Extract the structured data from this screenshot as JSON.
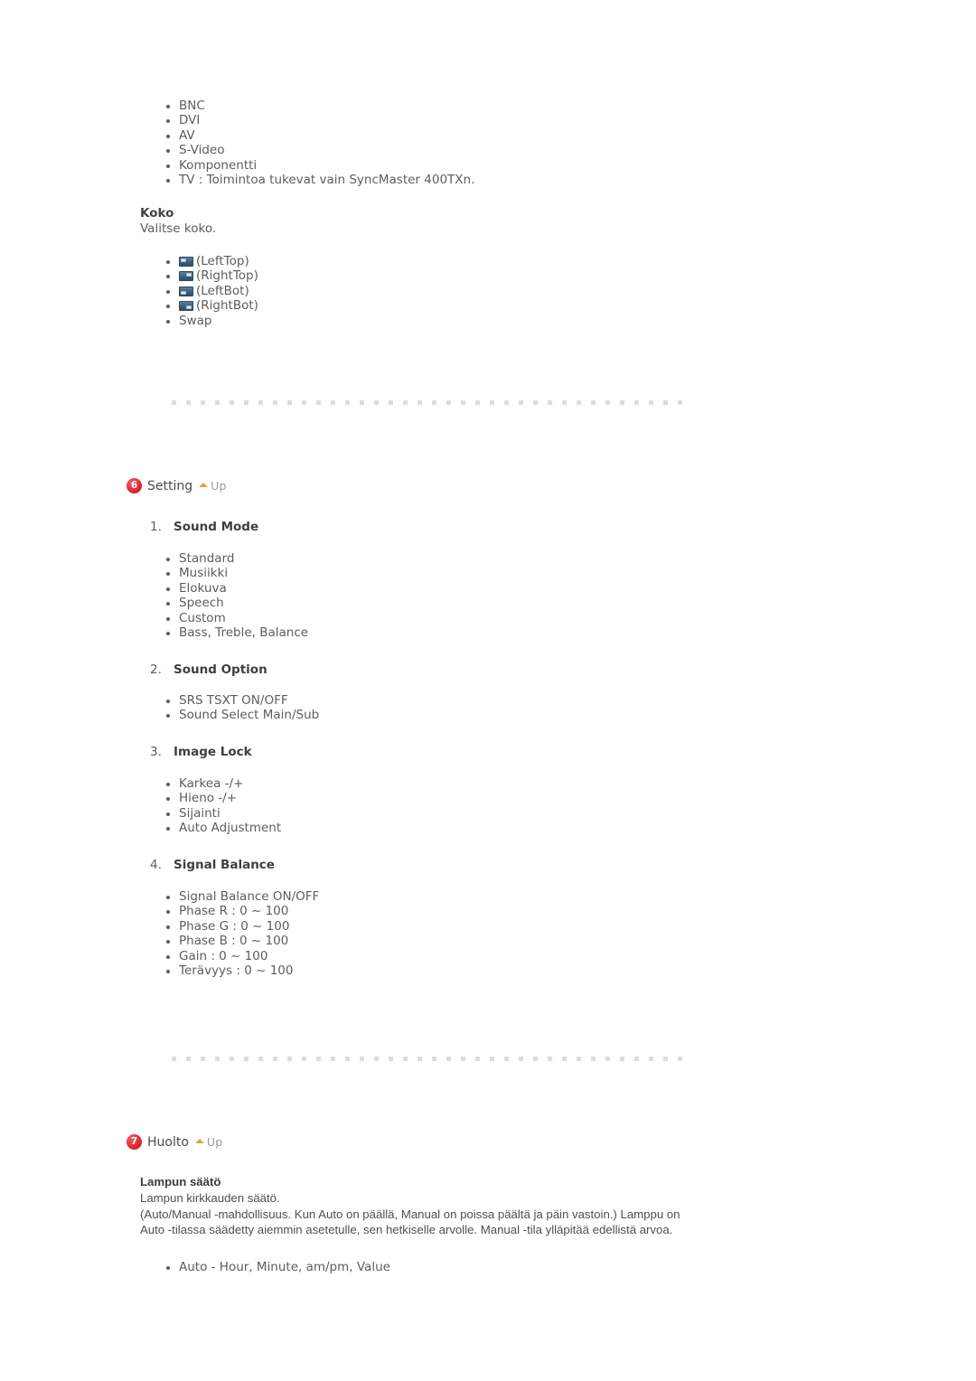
{
  "document": {
    "language": "fi",
    "background_color": "#ffffff",
    "text_color": "#5d5d5d",
    "heading_color": "#3f3f3f",
    "badge_color": "#e12a33",
    "up_arrow_color": "#e8a33d",
    "divider_color": "#dcdcdc",
    "pip_icon_color": "#3f6482"
  },
  "source_list": {
    "items": [
      "BNC",
      "DVI",
      "AV",
      "S-Video",
      "Komponentti",
      "TV : Toimintoa tukevat vain SyncMaster 400TXn."
    ]
  },
  "koko": {
    "title": "Koko",
    "description": "Valitse koko.",
    "items": [
      {
        "icon": "pip-position-lefttop-icon",
        "label": "(LeftTop)"
      },
      {
        "icon": "pip-position-righttop-icon",
        "label": "(RightTop)"
      },
      {
        "icon": "pip-position-leftbot-icon",
        "label": "(LeftBot)"
      },
      {
        "icon": "pip-position-rightbot-icon",
        "label": "(RightBot)"
      },
      {
        "icon": "",
        "label": "Swap"
      }
    ]
  },
  "setting_section": {
    "badge": "6",
    "title": "Setting",
    "up_label": "Up",
    "items": [
      {
        "number": "1.",
        "title": "Sound Mode",
        "bullets": [
          "Standard",
          "Musiikki",
          "Elokuva",
          "Speech",
          "Custom",
          "Bass, Treble, Balance"
        ]
      },
      {
        "number": "2.",
        "title": "Sound Option",
        "bullets": [
          "SRS TSXT ON/OFF",
          "Sound Select Main/Sub"
        ]
      },
      {
        "number": "3.",
        "title": "Image Lock",
        "bullets": [
          "Karkea -/+",
          "Hieno -/+",
          "Sijainti",
          "Auto Adjustment"
        ]
      },
      {
        "number": "4.",
        "title": "Signal Balance",
        "bullets": [
          "Signal Balance ON/OFF",
          "Phase R : 0 ~ 100",
          "Phase G : 0 ~ 100",
          "Phase B : 0 ~ 100",
          "Gain : 0 ~ 100",
          "Terävyys : 0 ~ 100"
        ]
      }
    ]
  },
  "huolto_section": {
    "badge": "7",
    "title": "Huolto",
    "up_label": "Up",
    "lamp": {
      "title": "Lampun säätö",
      "line1": "Lampun kirkkauden säätö.",
      "line2": "(Auto/Manual -mahdollisuus. Kun Auto on päällä, Manual on poissa päältä ja päin vastoin.) Lamppu on",
      "line3": "Auto -tilassa säädetty aiemmin asetetulle, sen hetkiselle arvolle. Manual -tila ylläpitää edellistä arvoa.",
      "bullets": [
        "Auto - Hour, Minute, am/pm, Value"
      ]
    }
  }
}
